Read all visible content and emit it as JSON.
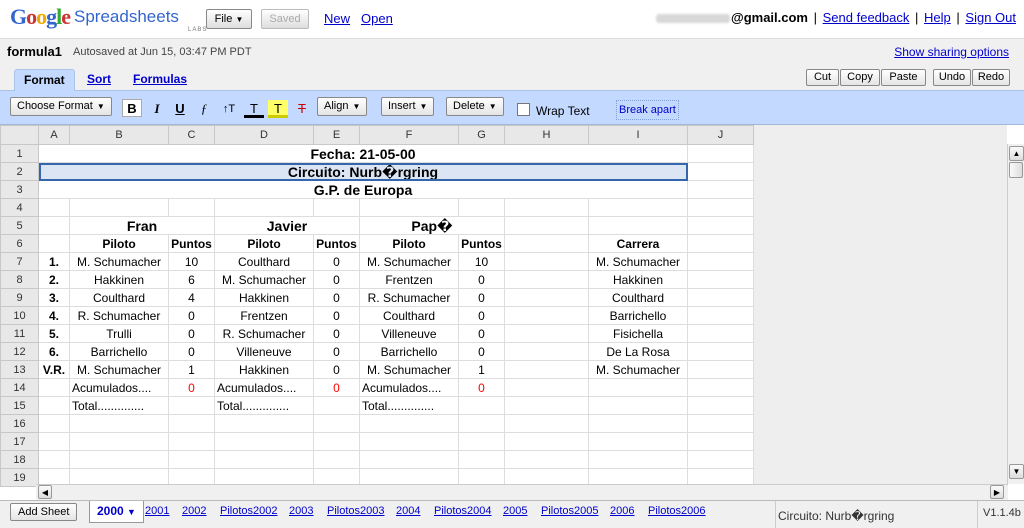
{
  "app": {
    "logo_text": "Google",
    "product": "Spreadsheets",
    "labs": "LABS"
  },
  "topbar": {
    "file_label": "File",
    "saved_label": "Saved",
    "new_label": "New",
    "open_label": "Open",
    "email_suffix": "@gmail.com",
    "send_feedback": "Send feedback",
    "help": "Help",
    "sign_out": "Sign Out"
  },
  "doc": {
    "title": "formula1",
    "autosaved": "Autosaved at Jun 15, 03:47 PM PDT",
    "share_link": "Show sharing options"
  },
  "tabs": [
    {
      "label": "Format"
    },
    {
      "label": "Sort"
    },
    {
      "label": "Formulas"
    }
  ],
  "edit_buttons": [
    "Cut",
    "Copy",
    "Paste",
    "Undo",
    "Redo"
  ],
  "toolbar": {
    "choose_format": "Choose Format",
    "bold": "B",
    "italic": "I",
    "underline": "U",
    "font_icon": "ƒ",
    "size_icon": "↑T",
    "text_color_icon": "T",
    "highlight_icon": "T",
    "clear_icon": "T",
    "align": "Align",
    "insert": "Insert",
    "delete": "Delete",
    "wrap_text": "Wrap Text",
    "break_apart": "Break apart"
  },
  "columns": [
    "A",
    "B",
    "C",
    "D",
    "E",
    "F",
    "G",
    "H",
    "I",
    "J"
  ],
  "sheet": {
    "r1": "Fecha: 21-05-00",
    "r2": "Circuito: Nurb�rgring",
    "r3": "G.P. de Europa",
    "names": [
      "Fran",
      "Javier",
      "Pap�"
    ],
    "headers": {
      "piloto": "Piloto",
      "puntos": "Puntos",
      "carrera": "Carrera"
    },
    "rows": [
      {
        "pos": "1.",
        "b": "M. Schumacher",
        "c": "10",
        "d": "Coulthard",
        "e": "0",
        "f": "M. Schumacher",
        "g": "10",
        "i": "M. Schumacher"
      },
      {
        "pos": "2.",
        "b": "Hakkinen",
        "c": "6",
        "d": "M. Schumacher",
        "e": "0",
        "f": "Frentzen",
        "g": "0",
        "i": "Hakkinen"
      },
      {
        "pos": "3.",
        "b": "Coulthard",
        "c": "4",
        "d": "Hakkinen",
        "e": "0",
        "f": "R. Schumacher",
        "g": "0",
        "i": "Coulthard"
      },
      {
        "pos": "4.",
        "b": "R. Schumacher",
        "c": "0",
        "d": "Frentzen",
        "e": "0",
        "f": "Coulthard",
        "g": "0",
        "i": "Barrichello"
      },
      {
        "pos": "5.",
        "b": "Trulli",
        "c": "0",
        "d": "R. Schumacher",
        "e": "0",
        "f": "Villeneuve",
        "g": "0",
        "i": "Fisichella"
      },
      {
        "pos": "6.",
        "b": "Barrichello",
        "c": "0",
        "d": "Villeneuve",
        "e": "0",
        "f": "Barrichello",
        "g": "0",
        "i": "De La Rosa"
      },
      {
        "pos": "V.R.",
        "b": "M. Schumacher",
        "c": "1",
        "d": "Hakkinen",
        "e": "0",
        "f": "M. Schumacher",
        "g": "1",
        "i": "M. Schumacher"
      }
    ],
    "acumulados": "Acumulados....",
    "acum_value": "0",
    "total": "Total.............."
  },
  "colors": {
    "toolbar_bg": "#c3d9ff",
    "link": "#0000cc",
    "accent_red": "#ff0000"
  },
  "sheetbar": {
    "add_sheet": "Add Sheet",
    "active_sheet": "2000",
    "sheets": [
      "2001",
      "2002",
      "Pilotos2002",
      "2003",
      "Pilotos2003",
      "2004",
      "Pilotos2004",
      "2005",
      "Pilotos2005",
      "2006",
      "Pilotos2006"
    ],
    "cell_ref": "Circuito: Nurb�rgring",
    "version": "V1.1.4b"
  }
}
